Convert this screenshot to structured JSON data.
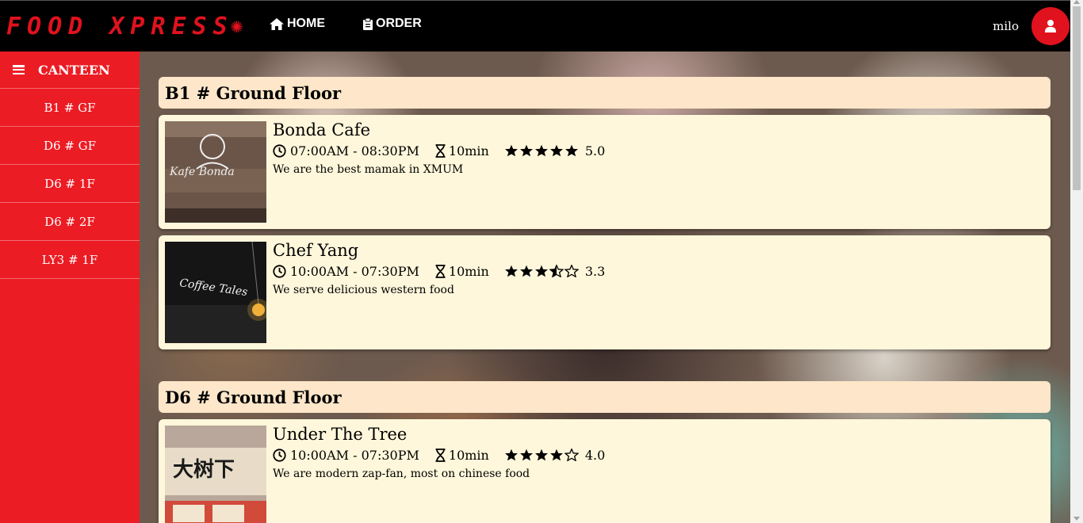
{
  "brand": {
    "logo_text": "FOOD XPRESS",
    "logo_icon": "flower-icon"
  },
  "nav": {
    "home": "HOME",
    "order": "ORDER"
  },
  "user": {
    "name": "milo"
  },
  "sidebar": {
    "title": "CANTEEN",
    "items": [
      {
        "label": "B1 # GF"
      },
      {
        "label": "D6 # GF"
      },
      {
        "label": "D6 # 1F"
      },
      {
        "label": "D6 # 2F"
      },
      {
        "label": "LY3 # 1F"
      }
    ]
  },
  "floors": [
    {
      "title": "B1 # Ground Floor",
      "stalls": [
        {
          "name": "Bonda Cafe",
          "hours": "07:00AM - 08:30PM",
          "prep": "10min",
          "stars": 5,
          "rating": "5.0",
          "desc": "We are the best mamak in XMUM",
          "thumb_text": "Kafe Bonda"
        },
        {
          "name": "Chef Yang",
          "hours": "10:00AM - 07:30PM",
          "prep": "10min",
          "stars": 3.5,
          "rating": "3.3",
          "desc": "We serve delicious western food",
          "thumb_text": "Coffee Tales"
        }
      ]
    },
    {
      "title": "D6 # Ground Floor",
      "stalls": [
        {
          "name": "Under The Tree",
          "hours": "10:00AM - 07:30PM",
          "prep": "10min",
          "stars": 4,
          "rating": "4.0",
          "desc": "We are modern zap-fan, most on chinese food",
          "thumb_text": "大树下"
        }
      ]
    }
  ],
  "colors": {
    "accent": "#ec1c24",
    "topbar": "#000000",
    "header_bg": "#fde6c9",
    "card_bg": "#fff7db"
  }
}
